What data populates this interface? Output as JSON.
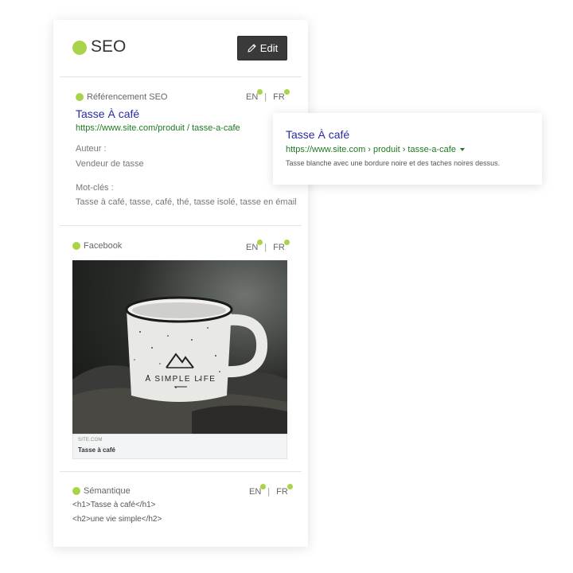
{
  "panel": {
    "title": "SEO",
    "edit_label": "Edit",
    "accent": "#a9d34a"
  },
  "seo_section": {
    "label": "Référencement SEO",
    "lang_en": "EN",
    "lang_fr": "FR",
    "separator": "|",
    "title": "Tasse À café",
    "url": "https://www.site.com/produit / tasse-a-cafe",
    "author_label": "Auteur :",
    "author_value": "Vendeur de tasse",
    "keywords_label": "Mot-clés :",
    "keywords_value": "Tasse à café, tasse, café, thé, tasse isolé, tasse en émail"
  },
  "facebook_section": {
    "label": "Facebook",
    "lang_en": "EN",
    "lang_fr": "FR",
    "separator": "|",
    "site": "SITE.COM",
    "card_title": "Tasse à café",
    "mug_text": "A SIMPLE LIFE"
  },
  "semantic_section": {
    "label": "Sémantique",
    "lang_en": "EN",
    "lang_fr": "FR",
    "separator": "|",
    "line1": "<h1>Tasse à café</h1>",
    "line2": "<h2>une vie simple</h2>"
  },
  "google_preview": {
    "title": "Tasse À café",
    "url": "https://www.site.com › produit › tasse-a-cafe",
    "description": "Tasse blanche avec une bordure noire et des taches noires dessus.",
    "link_color": "#2a2aa5",
    "url_color": "#1e7b1e"
  }
}
